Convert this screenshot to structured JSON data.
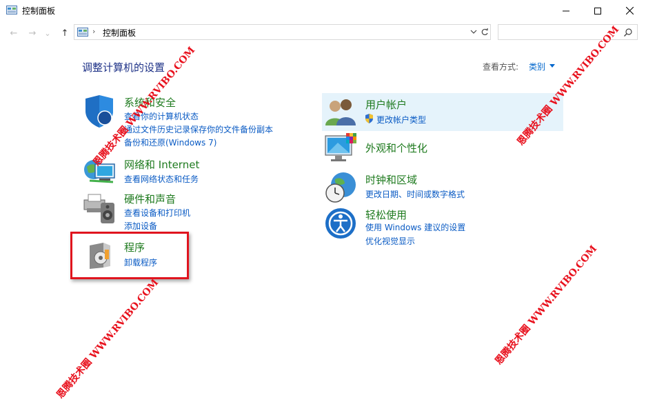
{
  "window": {
    "title": "控制面板",
    "minimize_glyph": "—",
    "maximize_glyph": "☐",
    "close_glyph": "✕"
  },
  "nav": {
    "back_glyph": "←",
    "forward_glyph": "→",
    "recent_glyph": "⌄",
    "up_glyph": "↑"
  },
  "address": {
    "separator": "›",
    "path": "控制面板"
  },
  "search": {
    "placeholder": ""
  },
  "content": {
    "heading": "调整计算机的设置",
    "view_by_label": "查看方式:",
    "view_by_value": "类别"
  },
  "categories": {
    "system": {
      "title": "系统和安全",
      "links": [
        "查看你的计算机状态",
        "通过文件历史记录保存你的文件备份副本",
        "备份和还原(Windows 7)"
      ]
    },
    "network": {
      "title": "网络和 Internet",
      "links": [
        "查看网络状态和任务"
      ]
    },
    "hardware": {
      "title": "硬件和声音",
      "links": [
        "查看设备和打印机",
        "添加设备"
      ]
    },
    "programs": {
      "title": "程序",
      "links": [
        "卸载程序"
      ]
    },
    "user": {
      "title": "用户帐户",
      "links": [
        "更改帐户类型"
      ]
    },
    "appearance": {
      "title": "外观和个性化",
      "links": []
    },
    "clock": {
      "title": "时钟和区域",
      "links": [
        "更改日期、时间或数字格式"
      ]
    },
    "ease": {
      "title": "轻松使用",
      "links": [
        "使用 Windows 建议的设置",
        "优化视觉显示"
      ]
    }
  },
  "watermark": {
    "text": "恩腾技术圈 WWW.RVIBO.COM"
  },
  "colors": {
    "heading": "#1e3287",
    "category_title": "#1e7a1e",
    "link": "#0a5bc4",
    "highlight": "#e5f3fb",
    "annotation_red": "#e0141e",
    "watermark": "#e8101c"
  }
}
